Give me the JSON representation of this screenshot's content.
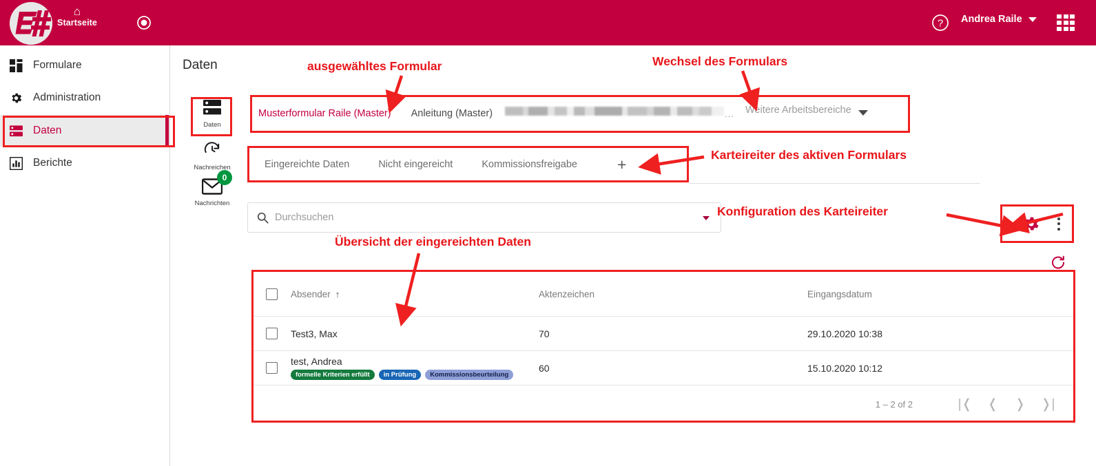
{
  "topbar": {
    "logo_name": "logo",
    "home_label": "Startseite",
    "home_icon": "home-icon",
    "record_icon": "record-icon",
    "help_icon": "help-icon",
    "user_name": "Andrea Raile",
    "apps_icon": "apps-grid-icon"
  },
  "sidebar": {
    "items": [
      {
        "label": "Formulare",
        "icon": "dashboard-icon",
        "active": false
      },
      {
        "label": "Administration",
        "icon": "gear-icon",
        "active": false
      },
      {
        "label": "Daten",
        "icon": "server-icon",
        "active": true
      },
      {
        "label": "Berichte",
        "icon": "bar-chart-icon",
        "active": false
      }
    ]
  },
  "page": {
    "title": "Daten"
  },
  "rail": {
    "items": [
      {
        "label": "Daten",
        "icon": "server-icon",
        "badge": null
      },
      {
        "label": "Nachreichen",
        "icon": "clock-arrow-icon",
        "badge": null
      },
      {
        "label": "Nachrichten",
        "icon": "envelope-icon",
        "badge": "0"
      }
    ]
  },
  "form_tabs": {
    "items": [
      {
        "label": "Musterformular Raile (Master)",
        "active": true
      },
      {
        "label": "Anleitung (Master)",
        "active": false
      }
    ],
    "redacted_ellipsis": "...",
    "more_label": "Weitere Arbeitsbereiche"
  },
  "card_tabs": {
    "items": [
      {
        "label": "Eingereichte Daten"
      },
      {
        "label": "Nicht eingereicht"
      },
      {
        "label": "Kommissionsfreigabe"
      }
    ],
    "add_label": "+"
  },
  "search": {
    "placeholder": "Durchsuchen"
  },
  "actions": {
    "gear": "gear-icon",
    "kebab": "more-vertical-icon",
    "refresh": "refresh-icon"
  },
  "table": {
    "columns": [
      "Absender",
      "Aktenzeichen",
      "Eingangsdatum"
    ],
    "sort_column": "Absender",
    "sort_arrow": "↑",
    "rows": [
      {
        "absender": "Test3, Max",
        "aktenzeichen": "70",
        "eingangsdatum": "29.10.2020 10:38",
        "badges": []
      },
      {
        "absender": "test, Andrea",
        "aktenzeichen": "60",
        "eingangsdatum": "15.10.2020 10:12",
        "badges": [
          {
            "label": "formelle Kriterien erfüllt",
            "color": "#147a3d"
          },
          {
            "label": "in Prüfung",
            "color": "#1866b5"
          },
          {
            "label": "Kommissionsbeurteilung",
            "color": "#8e9fd8"
          }
        ]
      }
    ],
    "pagination": {
      "range_label": "1 – 2 of 2",
      "first": "|❬",
      "prev": "❬",
      "next": "❭",
      "last": "❭|"
    }
  },
  "annotations": {
    "color": "#e8161a",
    "items": [
      {
        "text": "ausgewähltes Formular"
      },
      {
        "text": "Wechsel des Formulars"
      },
      {
        "text": "Karteireiter des aktiven Formulars"
      },
      {
        "text": "Konfiguration des Karteireiter"
      },
      {
        "text": "Übersicht der eingereichten Daten"
      }
    ]
  },
  "colors": {
    "brand": "#c3003f",
    "annotation": "#e8161a",
    "badge_green": "#00963f"
  }
}
